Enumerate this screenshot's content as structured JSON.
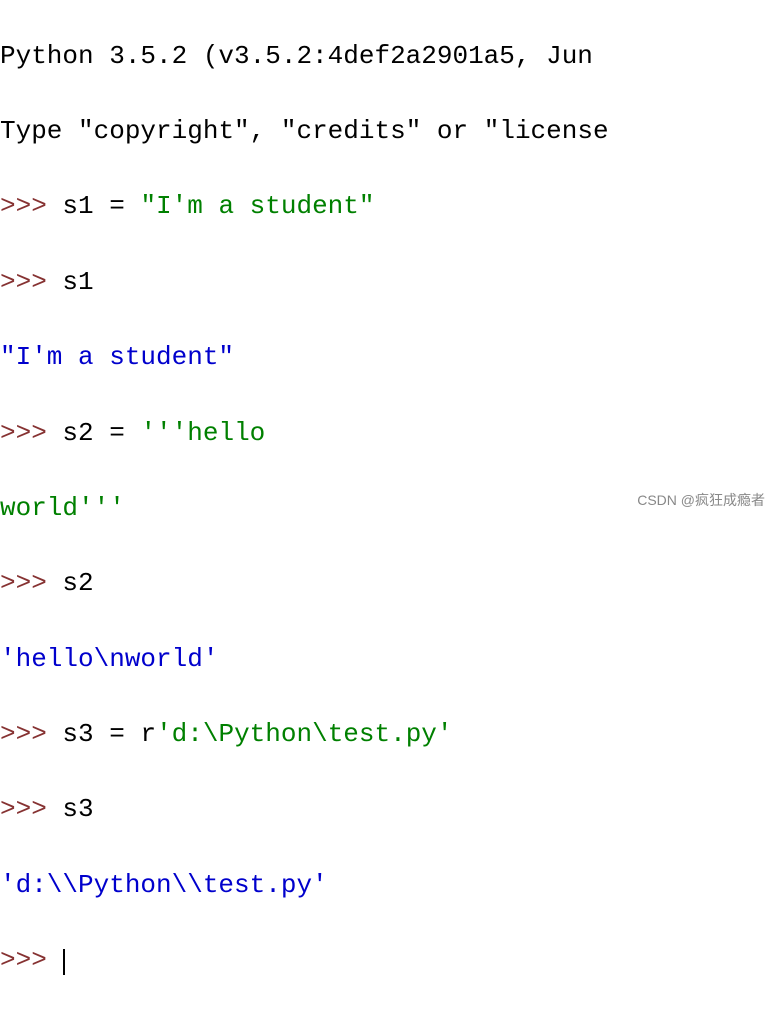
{
  "header": {
    "line1": "Python 3.5.2 (v3.5.2:4def2a2901a5, Jun ",
    "line2_a": "Type ",
    "line2_b": "\"copyright\"",
    "line2_c": ", ",
    "line2_d": "\"credits\"",
    "line2_e": " or ",
    "line2_f": "\"license"
  },
  "prompt": ">>> ",
  "session": {
    "l1_var": "s1 ",
    "l1_op": "= ",
    "l1_str": "\"I'm a student\"",
    "l2_var": "s1",
    "l3_out": "\"I'm a student\"",
    "l4_var": "s2 ",
    "l4_op": "= ",
    "l4_str": "'''hello",
    "l5_str": "world'''",
    "l6_var": "s2",
    "l7_out": "'hello\\nworld'",
    "l8_var": "s3 ",
    "l8_op": "= ",
    "l8_pfx": "r",
    "l8_str": "'d:\\Python\\test.py'",
    "l9_var": "s3",
    "l10_out": "'d:\\\\Python\\\\test.py'"
  },
  "watermark": "CSDN @疯狂成瘾者"
}
